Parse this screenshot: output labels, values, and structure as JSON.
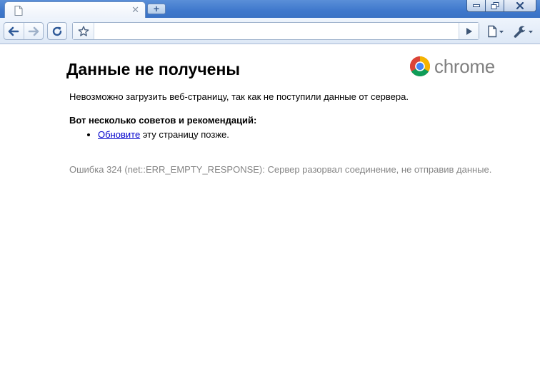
{
  "tab": {
    "title": "",
    "favicon": "page-icon"
  },
  "omnibox": {
    "value": "",
    "star_icon": "star-icon",
    "go_icon": "go-arrow-icon"
  },
  "toolbar": {
    "back_icon": "back-arrow-icon",
    "forward_icon": "forward-arrow-icon",
    "reload_icon": "reload-icon",
    "page_menu_icon": "page-menu-icon",
    "wrench_menu_icon": "wrench-icon"
  },
  "brand": {
    "text": "chrome",
    "text_color": "#808080"
  },
  "error": {
    "title": "Данные не получены",
    "summary": "Невозможно загрузить веб-страницу, так как не поступили данные от сервера.",
    "suggestions_heading": "Вот несколько советов и рекомендаций:",
    "suggestion_link": "Обновите",
    "suggestion_rest": " эту страницу позже.",
    "details": "Ошибка 324 (net::ERR_EMPTY_RESPONSE): Сервер разорвал соединение, не отправив данные.",
    "details_color": "#858585",
    "link_color": "#0000cc"
  },
  "colors": {
    "titlebar": "#3f78cc",
    "toolbar": "#dde8f6"
  }
}
